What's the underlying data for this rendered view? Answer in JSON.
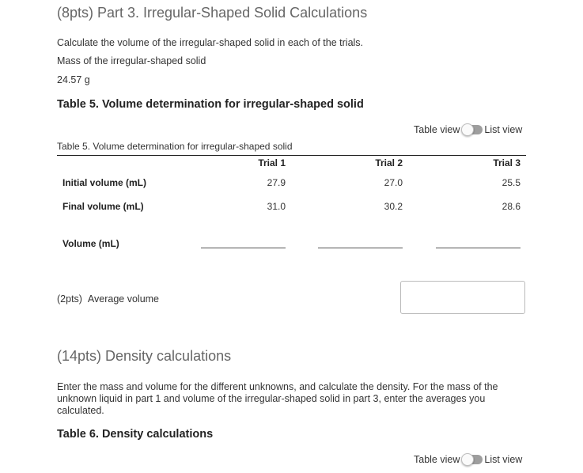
{
  "part3": {
    "heading": "(8pts) Part 3. Irregular-Shaped Solid Calculations",
    "instruction": "Calculate the volume of the irregular-shaped solid in each of the trials.",
    "mass_label": "Mass of the irregular-shaped solid",
    "mass_value": "24.57 g"
  },
  "table5": {
    "heading": "Table 5. Volume determination for irregular-shaped solid",
    "toggle": {
      "table_view": "Table view",
      "list_view": "List view"
    },
    "caption": "Table 5. Volume determination for irregular-shaped solid",
    "columns": [
      "Trial 1",
      "Trial 2",
      "Trial 3"
    ],
    "rows": [
      {
        "label": "Initial volume (mL)",
        "values": [
          "27.9",
          "27.0",
          "25.5"
        ]
      },
      {
        "label": "Final volume (mL)",
        "values": [
          "31.0",
          "30.2",
          "28.6"
        ]
      },
      {
        "label": "Volume (mL)",
        "values": [
          "",
          "",
          ""
        ]
      }
    ],
    "average_points": "(2pts)",
    "average_label": "Average volume",
    "average_value": ""
  },
  "density": {
    "heading": "(14pts) Density calculations",
    "instruction_line1": "Enter the mass and volume for the different unknowns, and calculate the density. For the mass of the",
    "instruction_line2": "unknown liquid in part 1 and volume of the irregular-shaped solid in part 3, enter the averages you",
    "instruction_line3": "calculated."
  },
  "table6": {
    "heading": "Table 6. Density calculations",
    "toggle": {
      "table_view": "Table view",
      "list_view": "List view"
    }
  }
}
